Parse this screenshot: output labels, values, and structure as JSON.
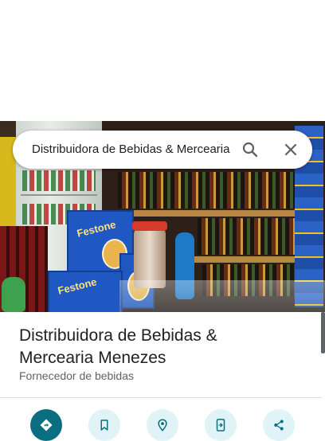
{
  "search": {
    "query": "Distribuidora de Bebidas & Mercearia"
  },
  "photo": {
    "box_label": "Festone"
  },
  "place": {
    "title": "Distribuidora de Bebidas & Mercearia Menezes",
    "category": "Fornecedor de bebidas"
  },
  "actions": [
    {
      "icon": "directions-icon"
    },
    {
      "icon": "bookmark-icon"
    },
    {
      "icon": "nearby-icon"
    },
    {
      "icon": "send-to-phone-icon"
    },
    {
      "icon": "share-icon"
    }
  ],
  "colors": {
    "primary_action": "#0b6e80",
    "action_bg": "#e0f3f7",
    "action_icon": "#0b6e80",
    "title_text": "#202124",
    "secondary_text": "#5f6368"
  }
}
